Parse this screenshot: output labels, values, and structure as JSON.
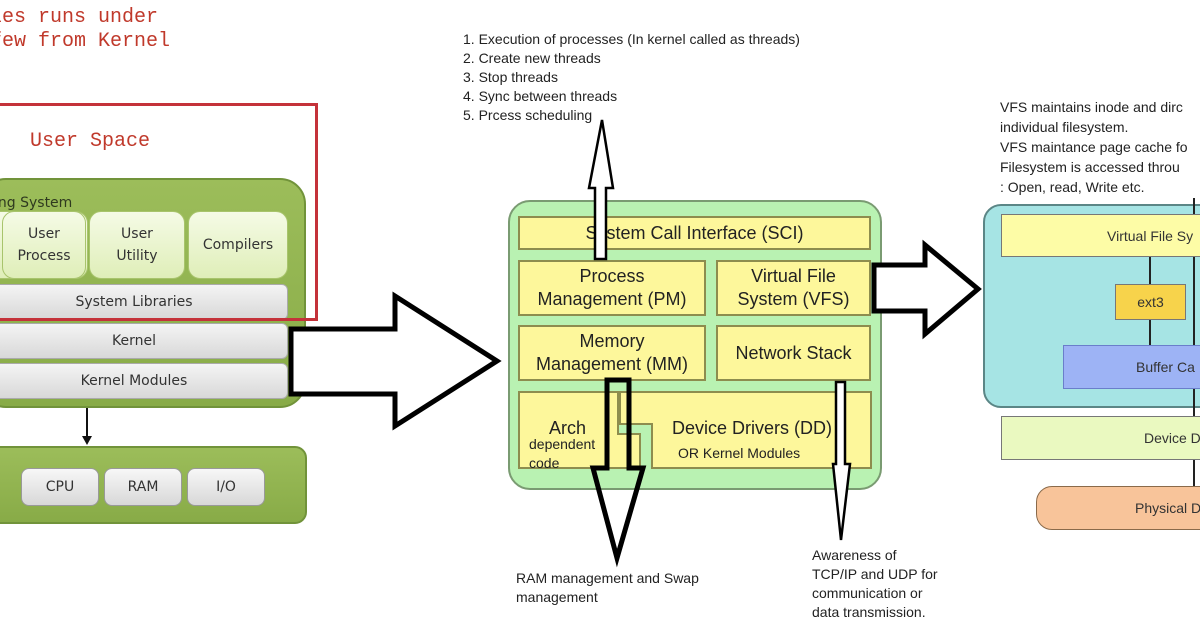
{
  "left_panel": {
    "caption_lines": [
      "les runs under",
      "few from Kernel"
    ],
    "user_space_label": "User Space",
    "os_label": "ing System",
    "apps": [
      {
        "label": "User\nProcess"
      },
      {
        "label": "User\nUtility"
      },
      {
        "label": "Compilers"
      }
    ],
    "layers": [
      "System Libraries",
      "Kernel",
      "Kernel Modules"
    ],
    "hardware": [
      "CPU",
      "RAM",
      "I/O"
    ]
  },
  "middle_panel": {
    "process_notes": [
      "1. Execution of processes (In kernel called as threads)",
      "2. Create new threads",
      "3. Stop threads",
      "4. Sync between threads",
      "5. Prcess scheduling"
    ],
    "kernel_components": {
      "sci": "System Call Interface (SCI)",
      "pm": "Process\nManagement (PM)",
      "vfs": "Virtual File\nSystem (VFS)",
      "mm": "Memory\nManagement (MM)",
      "net": "Network Stack",
      "arch": "Arch",
      "arch_sub": "dependent\ncode",
      "dd": "Device Drivers (DD)",
      "dd_sub": "OR Kernel Modules"
    },
    "mm_note": [
      "RAM management and Swap",
      "management"
    ],
    "net_note": [
      "Awareness of",
      "TCP/IP and UDP for",
      "communication or",
      "data transmission."
    ]
  },
  "right_panel": {
    "vfs_notes": [
      "VFS maintains inode and dirc",
      "individual filesystem.",
      "VFS maintance page cache fo",
      "Filesystem is accessed throu",
      ": Open, read, Write etc."
    ],
    "layers": {
      "vfs": "Virtual File Sy",
      "ext3": "ext3",
      "buffer_cache": "Buffer Ca",
      "device_drivers": "Device D",
      "physical": "Physical D"
    }
  },
  "colors": {
    "user_space_border": "#c4323a",
    "os_green": "#9cbd5a",
    "kernel_green": "#b9f2b2",
    "component_yellow": "#fdf79b",
    "vfs_cyan": "#a6e4e4",
    "ext3_orange": "#f7d34b",
    "buffer_blue": "#9db3f5",
    "device_lime": "#eaf9c0",
    "physical_peach": "#f8c49a"
  }
}
